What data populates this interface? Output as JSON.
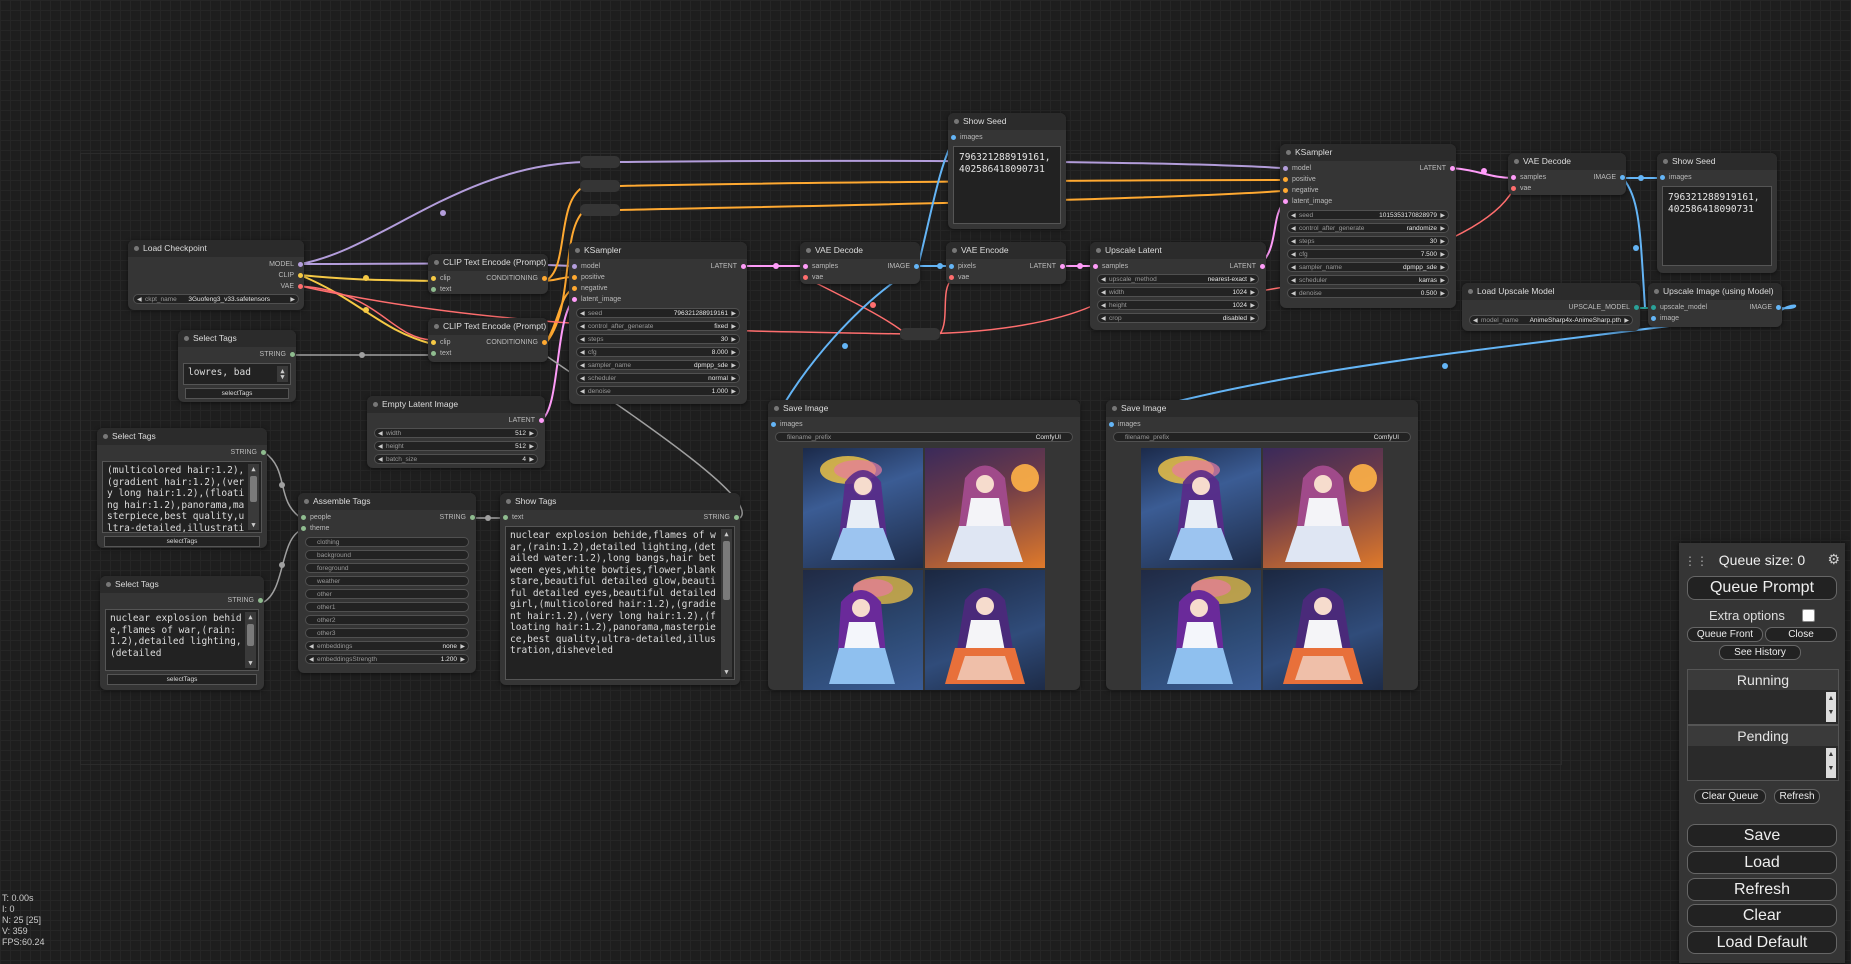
{
  "stats": {
    "lines": [
      "T: 0.00s",
      "I: 0",
      "N: 25 [25]",
      "V: 359",
      "FPS:60.24"
    ]
  },
  "colors": {
    "model": "#b39ddb",
    "clip": "#f6c945",
    "vae": "#ff6e6e",
    "conditioning": "#ffa931",
    "latent": "#ff9cf9",
    "image": "#64b5f6",
    "string": "#8fbc8f",
    "upscale_model": "#2aa198"
  },
  "nodes": {
    "load_checkpoint": {
      "title": "Load Checkpoint",
      "outputs": [
        "MODEL",
        "CLIP",
        "VAE"
      ],
      "ckpt_label": "ckpt_name",
      "ckpt_value": "3Guofeng3_v33.safetensors"
    },
    "select_tags_1": {
      "title": "Select Tags",
      "output": "STRING",
      "text": "lowres, bad",
      "button": "selectTags"
    },
    "select_tags_2": {
      "title": "Select Tags",
      "output": "STRING",
      "text": "(multicolored hair:1.2),(gradient hair:1.2),(very long hair:1.2),(floating hair:1.2),panorama,masterpiece,best quality,ultra-detailed,illustration",
      "button": "selectTags"
    },
    "select_tags_3": {
      "title": "Select Tags",
      "output": "STRING",
      "text": "nuclear explosion behide,flames of war,(rain:1.2),detailed lighting,(detailed",
      "button": "selectTags"
    },
    "clip_encode_1": {
      "title": "CLIP Text Encode (Prompt)",
      "inputs": [
        "clip",
        "text"
      ],
      "output": "CONDITIONING"
    },
    "clip_encode_2": {
      "title": "CLIP Text Encode (Prompt)",
      "inputs": [
        "clip",
        "text"
      ],
      "output": "CONDITIONING"
    },
    "empty_latent": {
      "title": "Empty Latent Image",
      "output": "LATENT",
      "widgets": [
        {
          "label": "width",
          "value": "512"
        },
        {
          "label": "height",
          "value": "512"
        },
        {
          "label": "batch_size",
          "value": "4"
        }
      ]
    },
    "assemble_tags": {
      "title": "Assemble Tags",
      "inputs": [
        "people",
        "theme"
      ],
      "output": "STRING",
      "fields": [
        "clothing",
        "background",
        "foreground",
        "weather",
        "other",
        "other1",
        "other2",
        "other3"
      ],
      "widgets": [
        {
          "label": "embeddings",
          "value": "none"
        },
        {
          "label": "embeddingsStrength",
          "value": "1.200"
        }
      ]
    },
    "show_tags": {
      "title": "Show Tags",
      "input": "text",
      "output": "STRING",
      "text": "nuclear explosion behide,flames of war,(rain:1.2),detailed lighting,(detailed water:1.2),long bangs,hair between eyes,white bowties,flower,blank stare,beautiful detailed glow,beautiful detailed eyes,beautiful detailed girl,(multicolored hair:1.2),(gradient hair:1.2),(very long hair:1.2),(floating hair:1.2),panorama,masterpiece,best quality,ultra-detailed,illustration,disheveled"
    },
    "ksampler_1": {
      "title": "KSampler",
      "inputs": [
        "model",
        "positive",
        "negative",
        "latent_image"
      ],
      "output": "LATENT",
      "widgets": [
        {
          "label": "seed",
          "value": "796321288919161"
        },
        {
          "label": "control_after_generate",
          "value": "fixed"
        },
        {
          "label": "steps",
          "value": "30"
        },
        {
          "label": "cfg",
          "value": "8.000"
        },
        {
          "label": "sampler_name",
          "value": "dpmpp_sde"
        },
        {
          "label": "scheduler",
          "value": "normal"
        },
        {
          "label": "denoise",
          "value": "1.000"
        }
      ]
    },
    "vae_decode_1": {
      "title": "VAE Decode",
      "inputs": [
        "samples",
        "vae"
      ],
      "output": "IMAGE"
    },
    "vae_encode": {
      "title": "VAE Encode",
      "inputs": [
        "pixels",
        "vae"
      ],
      "output": "LATENT"
    },
    "show_seed_1": {
      "title": "Show Seed",
      "input": "images",
      "text": "796321288919161, 402586418090731"
    },
    "upscale_latent": {
      "title": "Upscale Latent",
      "input": "samples",
      "output": "LATENT",
      "widgets": [
        {
          "label": "upscale_method",
          "value": "nearest-exact"
        },
        {
          "label": "width",
          "value": "1024"
        },
        {
          "label": "height",
          "value": "1024"
        },
        {
          "label": "crop",
          "value": "disabled"
        }
      ]
    },
    "ksampler_2": {
      "title": "KSampler",
      "inputs": [
        "model",
        "positive",
        "negative",
        "latent_image"
      ],
      "output": "LATENT",
      "widgets": [
        {
          "label": "seed",
          "value": "1015353170828979"
        },
        {
          "label": "control_after_generate",
          "value": "randomize"
        },
        {
          "label": "steps",
          "value": "30"
        },
        {
          "label": "cfg",
          "value": "7.500"
        },
        {
          "label": "sampler_name",
          "value": "dpmpp_sde"
        },
        {
          "label": "scheduler",
          "value": "karras"
        },
        {
          "label": "denoise",
          "value": "0.500"
        }
      ]
    },
    "vae_decode_2": {
      "title": "VAE Decode",
      "inputs": [
        "samples",
        "vae"
      ],
      "output": "IMAGE"
    },
    "show_seed_2": {
      "title": "Show Seed",
      "input": "images",
      "text": "796321288919161, 402586418090731"
    },
    "load_upscale_model": {
      "title": "Load Upscale Model",
      "output": "UPSCALE_MODEL",
      "widget_label": "model_name",
      "widget_value": "AnimeSharp4x-AnimeSharp.pth"
    },
    "upscale_image": {
      "title": "Upscale Image (using Model)",
      "inputs": [
        "upscale_model",
        "image"
      ],
      "output": "IMAGE"
    },
    "save_image_1": {
      "title": "Save Image",
      "input": "images",
      "prefix_label": "filename_prefix",
      "prefix_value": "ComfyUI"
    },
    "save_image_2": {
      "title": "Save Image",
      "input": "images",
      "prefix_label": "filename_prefix",
      "prefix_value": "ComfyUI"
    }
  },
  "menu": {
    "queue_size": "Queue size: 0",
    "queue_prompt": "Queue Prompt",
    "extra_options": "Extra options",
    "queue_front": "Queue Front",
    "close": "Close",
    "see_history": "See History",
    "running": "Running",
    "pending": "Pending",
    "clear_queue": "Clear Queue",
    "refresh_small": "Refresh",
    "save": "Save",
    "load": "Load",
    "refresh": "Refresh",
    "clear": "Clear",
    "load_default": "Load Default"
  }
}
